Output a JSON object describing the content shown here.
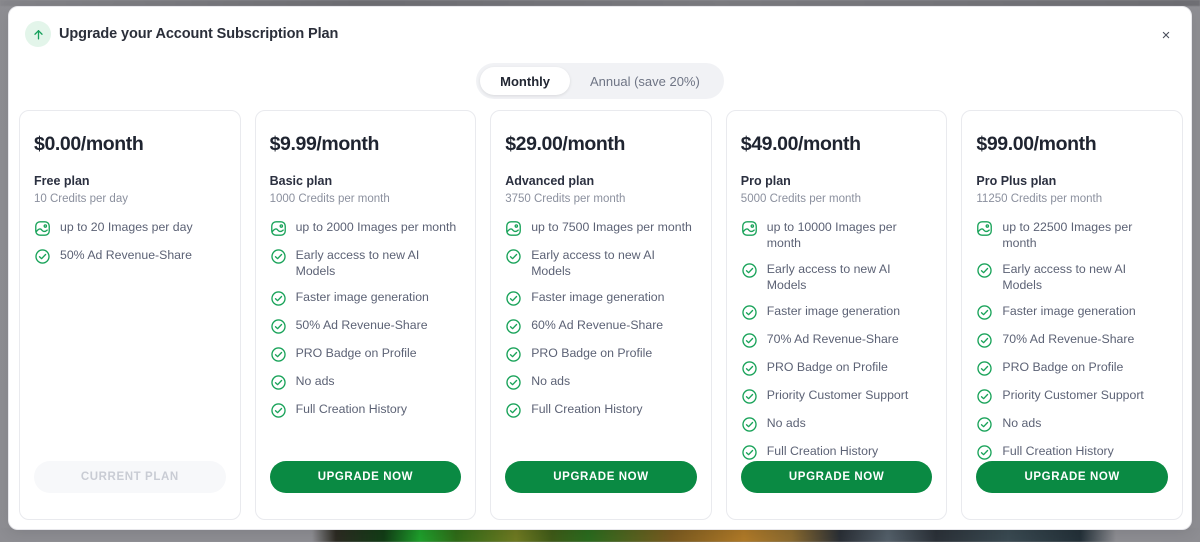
{
  "header": {
    "title": "Upgrade your Account Subscription Plan",
    "icon": "arrow-up-icon",
    "close_label": "×"
  },
  "billing_toggle": {
    "options": [
      {
        "label": "Monthly",
        "active": true
      },
      {
        "label": "Annual (save 20%)",
        "active": false
      }
    ]
  },
  "colors": {
    "accent_green": "#0a8a43",
    "icon_green": "#1aa35a",
    "text_dark": "#1f2430",
    "text_muted": "#8b909e"
  },
  "plans": [
    {
      "price": "$0.00/month",
      "name": "Free plan",
      "credits": "10 Credits per day",
      "features": [
        {
          "icon": "image-icon",
          "text": "up to 20 Images per day"
        },
        {
          "icon": "check-circle-icon",
          "text": "50% Ad Revenue-Share"
        }
      ],
      "button": {
        "label": "CURRENT PLAN",
        "state": "current"
      }
    },
    {
      "price": "$9.99/month",
      "name": "Basic plan",
      "credits": "1000 Credits per month",
      "features": [
        {
          "icon": "image-icon",
          "text": "up to 2000 Images per month"
        },
        {
          "icon": "check-circle-icon",
          "text": "Early access to new AI Models"
        },
        {
          "icon": "check-circle-icon",
          "text": "Faster image generation"
        },
        {
          "icon": "check-circle-icon",
          "text": "50% Ad Revenue-Share"
        },
        {
          "icon": "check-circle-icon",
          "text": "PRO Badge on Profile"
        },
        {
          "icon": "check-circle-icon",
          "text": "No ads"
        },
        {
          "icon": "check-circle-icon",
          "text": "Full Creation History"
        }
      ],
      "button": {
        "label": "UPGRADE NOW",
        "state": "upgrade"
      }
    },
    {
      "price": "$29.00/month",
      "name": "Advanced plan",
      "credits": "3750 Credits per month",
      "features": [
        {
          "icon": "image-icon",
          "text": "up to 7500 Images per month"
        },
        {
          "icon": "check-circle-icon",
          "text": "Early access to new AI Models"
        },
        {
          "icon": "check-circle-icon",
          "text": "Faster image generation"
        },
        {
          "icon": "check-circle-icon",
          "text": "60% Ad Revenue-Share"
        },
        {
          "icon": "check-circle-icon",
          "text": "PRO Badge on Profile"
        },
        {
          "icon": "check-circle-icon",
          "text": "No ads"
        },
        {
          "icon": "check-circle-icon",
          "text": "Full Creation History"
        }
      ],
      "button": {
        "label": "UPGRADE NOW",
        "state": "upgrade"
      }
    },
    {
      "price": "$49.00/month",
      "name": "Pro plan",
      "credits": "5000 Credits per month",
      "features": [
        {
          "icon": "image-icon",
          "text": "up to 10000 Images per month"
        },
        {
          "icon": "check-circle-icon",
          "text": "Early access to new AI Models"
        },
        {
          "icon": "check-circle-icon",
          "text": "Faster image generation"
        },
        {
          "icon": "check-circle-icon",
          "text": "70% Ad Revenue-Share"
        },
        {
          "icon": "check-circle-icon",
          "text": "PRO Badge on Profile"
        },
        {
          "icon": "check-circle-icon",
          "text": "Priority Customer Support"
        },
        {
          "icon": "check-circle-icon",
          "text": "No ads"
        },
        {
          "icon": "check-circle-icon",
          "text": "Full Creation History"
        }
      ],
      "button": {
        "label": "UPGRADE NOW",
        "state": "upgrade"
      }
    },
    {
      "price": "$99.00/month",
      "name": "Pro Plus plan",
      "credits": "11250 Credits per month",
      "features": [
        {
          "icon": "image-icon",
          "text": "up to 22500 Images per month"
        },
        {
          "icon": "check-circle-icon",
          "text": "Early access to new AI Models"
        },
        {
          "icon": "check-circle-icon",
          "text": "Faster image generation"
        },
        {
          "icon": "check-circle-icon",
          "text": "70% Ad Revenue-Share"
        },
        {
          "icon": "check-circle-icon",
          "text": "PRO Badge on Profile"
        },
        {
          "icon": "check-circle-icon",
          "text": "Priority Customer Support"
        },
        {
          "icon": "check-circle-icon",
          "text": "No ads"
        },
        {
          "icon": "check-circle-icon",
          "text": "Full Creation History"
        }
      ],
      "button": {
        "label": "UPGRADE NOW",
        "state": "upgrade"
      }
    }
  ]
}
